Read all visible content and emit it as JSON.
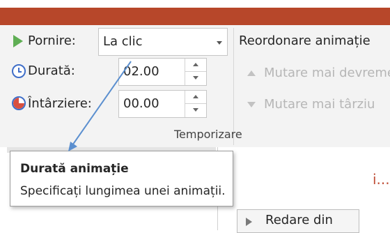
{
  "timing": {
    "start_label": "Pornire:",
    "start_value": "La clic",
    "duration_label": "Durată:",
    "duration_value": "02.00",
    "delay_label": "Întârziere:",
    "delay_value": "00.00",
    "group_label": "Temporizare"
  },
  "reorder": {
    "title": "Reordonare animație",
    "move_earlier": "Mutare mai devreme",
    "move_later": "Mutare mai târziu"
  },
  "tooltip": {
    "title": "Durată animație",
    "body": "Specificați lungimea unei animații."
  },
  "below": {
    "partial_text": "i...",
    "preview_from_label": "Redare din"
  },
  "colors": {
    "accent": "#b7472a",
    "play_green": "#5fae54",
    "icon_blue": "#3f6ec8",
    "annotation_arrow": "#5b8fcf"
  },
  "icons": [
    "play-icon",
    "clock-icon",
    "delay-icon",
    "chevron-down-icon",
    "move-up-icon",
    "move-down-icon"
  ]
}
